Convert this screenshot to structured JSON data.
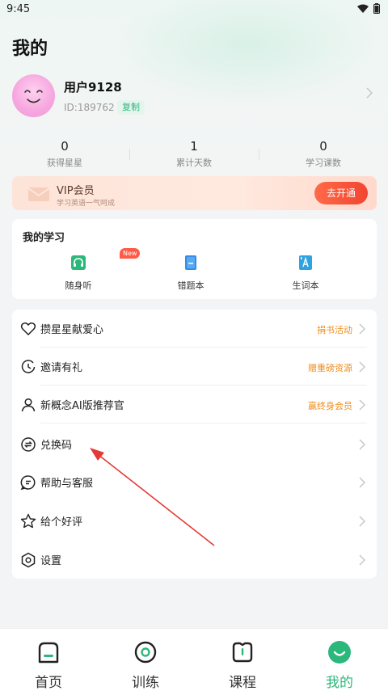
{
  "status_bar": {
    "time": "9:45"
  },
  "page": {
    "title": "我的"
  },
  "profile": {
    "name": "用户9128",
    "id_text": "ID:189762",
    "copy_label": "复制"
  },
  "stats": [
    {
      "value": "0",
      "label": "获得星星"
    },
    {
      "value": "1",
      "label": "累计天数"
    },
    {
      "value": "0",
      "label": "学习课数"
    }
  ],
  "vip": {
    "title": "VIP会员",
    "subtitle": "学习英语一气呵成",
    "button": "去开通"
  },
  "study": {
    "title": "我的学习",
    "new_badge": "New",
    "items": [
      {
        "label": "随身听",
        "icon": "headphones-icon"
      },
      {
        "label": "错题本",
        "icon": "notebook-icon"
      },
      {
        "label": "生词本",
        "icon": "vocabulary-book-icon"
      }
    ]
  },
  "menu": [
    {
      "label": "攒星星献爱心",
      "tag": "捐书活动",
      "icon": "heart-icon"
    },
    {
      "label": "邀请有礼",
      "tag": "赠重磅资源",
      "icon": "invite-icon"
    },
    {
      "label": "新概念AI版推荐官",
      "tag": "赢终身会员",
      "icon": "person-icon"
    },
    {
      "label": "兑换码",
      "tag": "",
      "icon": "exchange-icon"
    },
    {
      "label": "帮助与客服",
      "tag": "",
      "icon": "help-chat-icon"
    },
    {
      "label": "给个好评",
      "tag": "",
      "icon": "star-icon"
    },
    {
      "label": "设置",
      "tag": "",
      "icon": "settings-icon"
    }
  ],
  "tabs": [
    {
      "label": "首页",
      "icon": "home-icon",
      "active": false
    },
    {
      "label": "训练",
      "icon": "training-icon",
      "active": false
    },
    {
      "label": "课程",
      "icon": "course-icon",
      "active": false
    },
    {
      "label": "我的",
      "icon": "profile-smile-icon",
      "active": true
    }
  ],
  "colors": {
    "accent": "#2cb77b",
    "vip_button": "#f2452f",
    "tag": "#f08c1a",
    "arrow": "#e53935"
  }
}
